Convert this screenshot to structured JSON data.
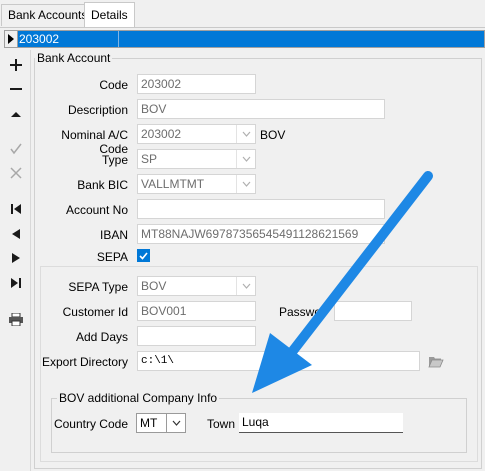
{
  "tabs": [
    {
      "label": "Bank Accounts"
    },
    {
      "label": "Details"
    }
  ],
  "record_bar": {
    "value": "203002"
  },
  "nav": {
    "icons": [
      "plus-icon",
      "minus-icon",
      "triangle-up-icon",
      "check-icon",
      "x-icon",
      "first-record-icon",
      "prev-record-icon",
      "next-record-icon",
      "last-record-icon",
      "print-icon"
    ]
  },
  "bank_account": {
    "group_title": "Bank Account",
    "code": {
      "label": "Code",
      "value": "203002"
    },
    "description": {
      "label": "Description",
      "value": "BOV"
    },
    "nominal": {
      "label": "Nominal A/C Code",
      "value": "203002",
      "suffix": "BOV"
    },
    "type": {
      "label": "Type",
      "value": "SP"
    },
    "bic": {
      "label": "Bank BIC",
      "value": "VALLMTMT"
    },
    "account_no": {
      "label": "Account No",
      "value": ""
    },
    "iban": {
      "label": "IBAN",
      "value": "MT88NAJW6978735654549112862​1569"
    },
    "sepa": {
      "label": "SEPA",
      "checked": true
    }
  },
  "sepa_section": {
    "sepa_type": {
      "label": "SEPA Type",
      "value": "BOV"
    },
    "customer_id": {
      "label": "Customer Id",
      "value": "BOV001"
    },
    "password": {
      "label": "Passwo",
      "value": ""
    },
    "add_days": {
      "label": "Add Days",
      "value": ""
    },
    "export_dir": {
      "label": "Export Directory",
      "value": "c:\\1\\"
    }
  },
  "company_info": {
    "group_title": "BOV additional Company Info",
    "country_code": {
      "label": "Country Code",
      "value": "MT"
    },
    "town": {
      "label": "Town",
      "value": "Luqa"
    }
  },
  "colors": {
    "accent": "#0078d7",
    "arrow": "#1e88e5"
  }
}
